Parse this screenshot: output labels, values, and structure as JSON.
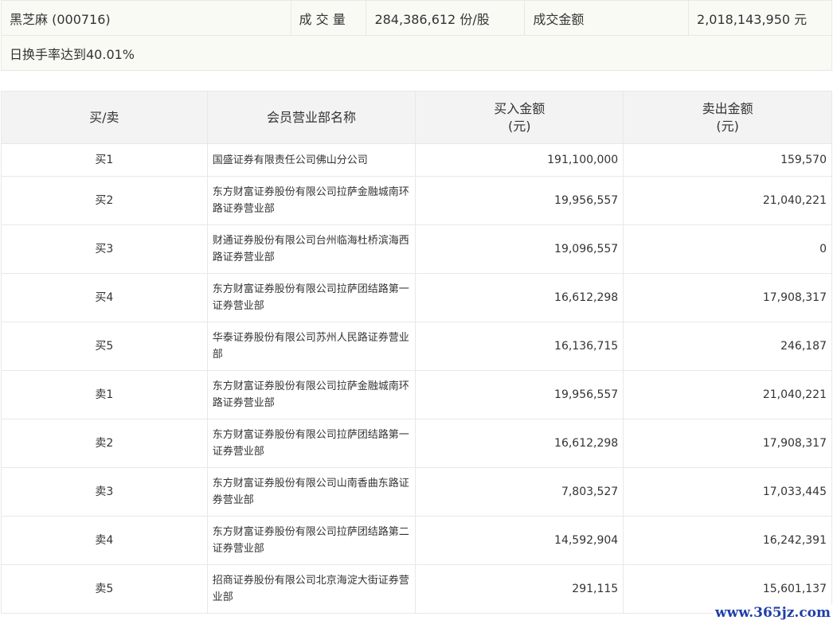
{
  "stock": {
    "name_code": "黑芝麻 (000716)",
    "volume_label": "成 交 量",
    "volume_value": "284,386,612 份/股",
    "amount_label": "成交金额",
    "amount_value": "2,018,143,950 元",
    "note": "日换手率达到40.01%"
  },
  "table": {
    "headers": {
      "side": "买/卖",
      "branch": "会员营业部名称",
      "buy_line1": "买入金额",
      "buy_line2": "(元)",
      "sell_line1": "卖出金额",
      "sell_line2": "(元)"
    },
    "rows": [
      {
        "side": "买1",
        "branch": "国盛证券有限责任公司佛山分公司",
        "buy": "191,100,000",
        "sell": "159,570"
      },
      {
        "side": "买2",
        "branch": "东方财富证券股份有限公司拉萨金融城南环路证券营业部",
        "buy": "19,956,557",
        "sell": "21,040,221"
      },
      {
        "side": "买3",
        "branch": "财通证券股份有限公司台州临海杜桥滨海西路证券营业部",
        "buy": "19,096,557",
        "sell": "0"
      },
      {
        "side": "买4",
        "branch": "东方财富证券股份有限公司拉萨团结路第一证券营业部",
        "buy": "16,612,298",
        "sell": "17,908,317"
      },
      {
        "side": "买5",
        "branch": "华泰证券股份有限公司苏州人民路证券营业部",
        "buy": "16,136,715",
        "sell": "246,187"
      },
      {
        "side": "卖1",
        "branch": "东方财富证券股份有限公司拉萨金融城南环路证券营业部",
        "buy": "19,956,557",
        "sell": "21,040,221"
      },
      {
        "side": "卖2",
        "branch": "东方财富证券股份有限公司拉萨团结路第一证券营业部",
        "buy": "16,612,298",
        "sell": "17,908,317"
      },
      {
        "side": "卖3",
        "branch": "东方财富证券股份有限公司山南香曲东路证券营业部",
        "buy": "7,803,527",
        "sell": "17,033,445"
      },
      {
        "side": "卖4",
        "branch": "东方财富证券股份有限公司拉萨团结路第二证券营业部",
        "buy": "14,592,904",
        "sell": "16,242,391"
      },
      {
        "side": "卖5",
        "branch": "招商证券股份有限公司北京海淀大街证券营业部",
        "buy": "291,115",
        "sell": "15,601,137"
      }
    ]
  },
  "watermark": "www.365jz.com"
}
